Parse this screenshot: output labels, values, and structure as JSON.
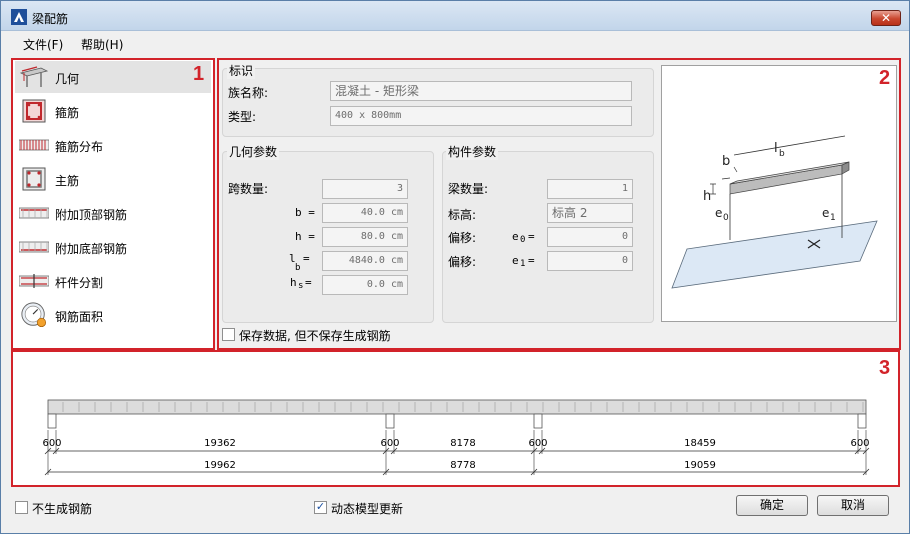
{
  "window": {
    "title": "梁配筋",
    "close_glyph": "✕"
  },
  "menu": {
    "file": "文件(F)",
    "help": "帮助(H)"
  },
  "frames": {
    "f1": "1",
    "f2": "2",
    "f3": "3"
  },
  "nav": {
    "items": [
      {
        "label": "几何",
        "icon": "geometry-icon",
        "selected": true
      },
      {
        "label": "箍筋",
        "icon": "stirrup-icon"
      },
      {
        "label": "箍筋分布",
        "icon": "stirrup-distribution-icon"
      },
      {
        "label": "主筋",
        "icon": "main-bar-icon"
      },
      {
        "label": "附加顶部钢筋",
        "icon": "additional-top-bar-icon"
      },
      {
        "label": "附加底部钢筋",
        "icon": "additional-bottom-bar-icon"
      },
      {
        "label": "杆件分割",
        "icon": "member-split-icon"
      },
      {
        "label": "钢筋面积",
        "icon": "rebar-area-gauge-icon"
      }
    ]
  },
  "identity": {
    "title": "标识",
    "family_label": "族名称:",
    "family_value": "混凝土 - 矩形梁",
    "type_label": "类型:",
    "type_value": "400 x 800mm"
  },
  "geometry": {
    "title": "几何参数",
    "spans_label": "跨数量:",
    "spans_value": "3",
    "b_label": "b =",
    "b_value": "40.0 cm",
    "h_label": "h =",
    "h_value": "80.0 cm",
    "lb_main": "l",
    "lb_eq": "=",
    "lb_sub": "b",
    "lb_value": "4840.0 cm",
    "hs_main": "h",
    "hs_sub": "s",
    "hs_eq": "=",
    "hs_value": "0.0 cm"
  },
  "member": {
    "title": "构件参数",
    "count_label": "梁数量:",
    "count_value": "1",
    "level_label": "标高:",
    "level_value": "标高 2",
    "offset1_label": "偏移:",
    "offset1_sym": "e",
    "offset1_sub": "0",
    "offset1_eq": "=",
    "offset1_value": "0",
    "offset2_label": "偏移:",
    "offset2_sym": "e",
    "offset2_sub": "1",
    "offset2_eq": "=",
    "offset2_value": "0"
  },
  "save_data_label": "保存数据, 但不保存生成钢筋",
  "preview_labels": {
    "lb": "l",
    "lb_sub": "b",
    "b": "b",
    "h": "h",
    "e0": "e",
    "e0_sub": "0",
    "e1": "e",
    "e1_sub": "1"
  },
  "span_diagram": {
    "top_row": [
      "600",
      "19362",
      "600",
      "8178",
      "600",
      "18459",
      "600"
    ],
    "bottom_row": [
      "19962",
      "8778",
      "19059"
    ]
  },
  "options": {
    "no_rebar_label": "不生成钢筋",
    "no_rebar_checked": false,
    "dynamic_label": "动态模型更新",
    "dynamic_checked": true
  },
  "buttons": {
    "ok": "确定",
    "cancel": "取消"
  },
  "colors": {
    "frame": "#d2232a",
    "beam": "#a8a8a8",
    "plane": "#dce8f5"
  }
}
